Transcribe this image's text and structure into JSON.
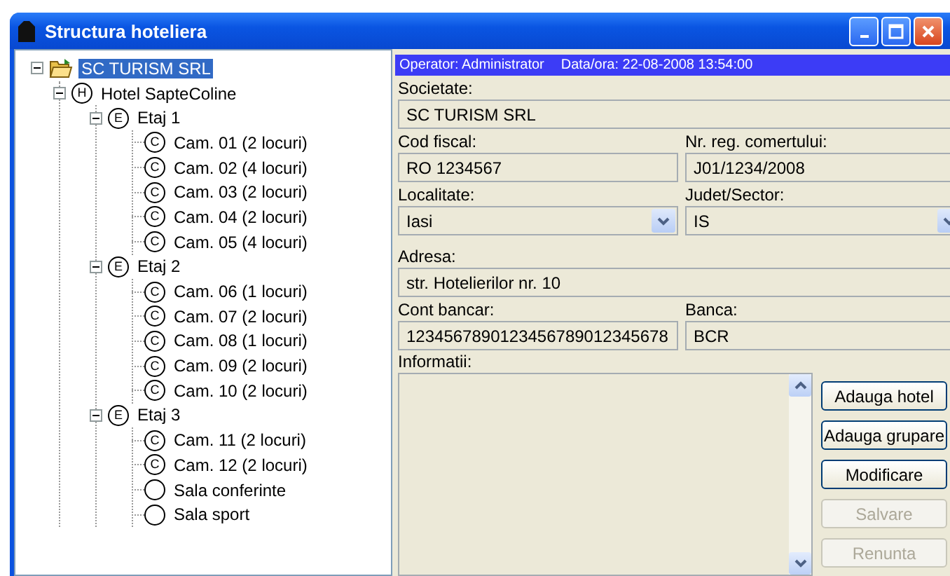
{
  "window": {
    "title": "Structura hoteliera"
  },
  "tree": [
    {
      "kind": "company",
      "label": "SC TURISM SRL",
      "selected": true,
      "expanded": true,
      "children": [
        {
          "kind": "hotel",
          "badge": "H",
          "label": "Hotel SapteColine",
          "selected": false,
          "expanded": true,
          "children": [
            {
              "kind": "floor",
              "badge": "E",
              "label": "Etaj 1",
              "selected": false,
              "expanded": true,
              "children": [
                {
                  "kind": "room",
                  "badge": "C",
                  "label": "Cam. 01 (2 locuri)",
                  "selected": false
                },
                {
                  "kind": "room",
                  "badge": "C",
                  "label": "Cam. 02 (4 locuri)",
                  "selected": false
                },
                {
                  "kind": "room",
                  "badge": "C",
                  "label": "Cam. 03 (2 locuri)",
                  "selected": false
                },
                {
                  "kind": "room",
                  "badge": "C",
                  "label": "Cam. 04 (2 locuri)",
                  "selected": false
                },
                {
                  "kind": "room",
                  "badge": "C",
                  "label": "Cam. 05 (4 locuri)",
                  "selected": false
                }
              ]
            },
            {
              "kind": "floor",
              "badge": "E",
              "label": "Etaj 2",
              "selected": false,
              "expanded": true,
              "children": [
                {
                  "kind": "room",
                  "badge": "C",
                  "label": "Cam. 06 (1 locuri)",
                  "selected": false
                },
                {
                  "kind": "room",
                  "badge": "C",
                  "label": "Cam. 07 (2 locuri)",
                  "selected": false
                },
                {
                  "kind": "room",
                  "badge": "C",
                  "label": "Cam. 08 (1 locuri)",
                  "selected": false
                },
                {
                  "kind": "room",
                  "badge": "C",
                  "label": "Cam. 09 (2 locuri)",
                  "selected": false
                },
                {
                  "kind": "room",
                  "badge": "C",
                  "label": "Cam. 10 (2 locuri)",
                  "selected": false
                }
              ]
            },
            {
              "kind": "floor",
              "badge": "E",
              "label": "Etaj 3",
              "selected": false,
              "expanded": true,
              "children": [
                {
                  "kind": "room",
                  "badge": "C",
                  "label": "Cam. 11 (2 locuri)",
                  "selected": false
                },
                {
                  "kind": "room",
                  "badge": "C",
                  "label": "Cam. 12 (2 locuri)",
                  "selected": false
                },
                {
                  "kind": "hall",
                  "label": "Sala conferinte",
                  "selected": false
                },
                {
                  "kind": "hall",
                  "label": "Sala sport",
                  "selected": false
                }
              ]
            }
          ]
        }
      ]
    }
  ],
  "status": {
    "operator": "Operator: Administrator",
    "datetime": "Data/ora: 22-08-2008 13:54:00"
  },
  "form": {
    "rows": [
      {
        "fields": [
          {
            "kind": "text",
            "label": "Societate:",
            "value": "SC TURISM SRL"
          }
        ]
      },
      {
        "fields": [
          {
            "kind": "text",
            "label": "Cod fiscal:",
            "value": "RO 1234567"
          },
          {
            "kind": "text",
            "label": "Nr. reg. comertului:",
            "value": "J01/1234/2008"
          }
        ]
      },
      {
        "fields": [
          {
            "kind": "select",
            "label": "Localitate:",
            "value": "Iasi"
          },
          {
            "kind": "select",
            "label": "Judet/Sector:",
            "value": "IS"
          }
        ]
      },
      {
        "fields": [
          {
            "kind": "text",
            "label": "Adresa:",
            "value": "str. Hotelierilor nr. 10"
          }
        ]
      },
      {
        "fields": [
          {
            "kind": "text",
            "label": "Cont bancar:",
            "value": "1234567890123456789012345678"
          },
          {
            "kind": "text",
            "label": "Banca:",
            "value": "BCR"
          }
        ]
      }
    ],
    "info": {
      "label": "Informatii:"
    }
  },
  "buttons": [
    {
      "label": "Adauga hotel",
      "disabled": false
    },
    {
      "label": "Adauga grupare",
      "disabled": false
    },
    {
      "label": "Modificare",
      "disabled": false
    },
    {
      "label": "Salvare",
      "disabled": true
    },
    {
      "label": "Renunta",
      "disabled": true
    }
  ]
}
